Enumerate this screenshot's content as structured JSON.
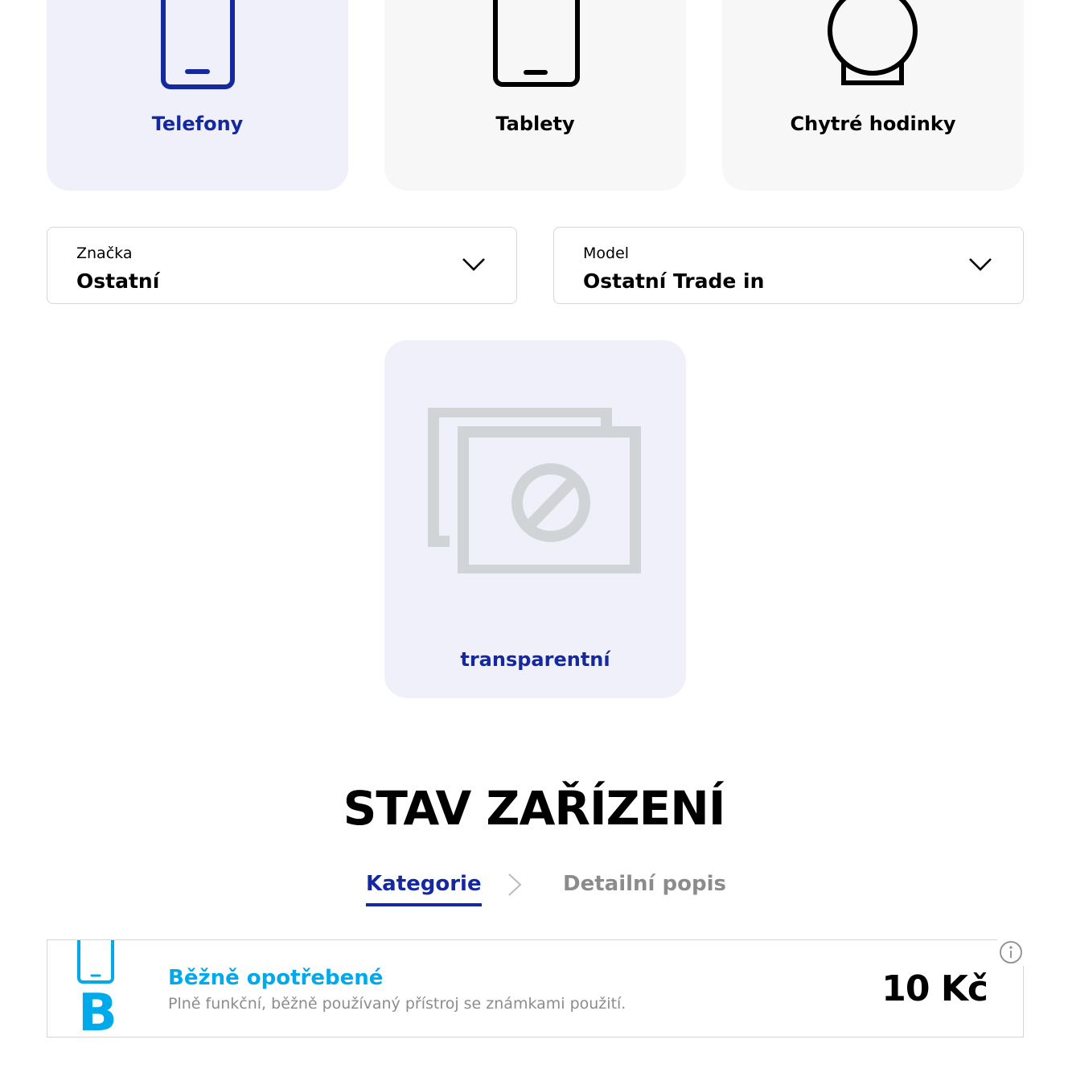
{
  "categories": [
    {
      "label": "Telefony",
      "icon": "phone-icon",
      "active": true
    },
    {
      "label": "Tablety",
      "icon": "tablet-icon",
      "active": false
    },
    {
      "label": "Chytré hodinky",
      "icon": "watch-icon",
      "active": false
    }
  ],
  "brand_select": {
    "label": "Značka",
    "value": "Ostatní"
  },
  "model_select": {
    "label": "Model",
    "value": "Ostatní Trade in"
  },
  "color_option": {
    "label": "transparentní",
    "icon": "image-placeholder-icon"
  },
  "section": {
    "title": "STAV ZAŘÍZENÍ"
  },
  "steps": [
    {
      "label": "Kategorie",
      "active": true
    },
    {
      "label": "Detailní popis",
      "active": false
    }
  ],
  "condition": {
    "grade": "B",
    "title": "Běžně opotřebené",
    "description": "Plně funkční, běžně používaný přístroj se známkami použití.",
    "price": "10 Kč"
  },
  "colors": {
    "accent": "#1428a0",
    "condition_accent": "#00aaea",
    "card_active_bg": "#f0f0fa",
    "card_bg": "#f7f7f7",
    "muted_text": "#8c8c8c"
  }
}
